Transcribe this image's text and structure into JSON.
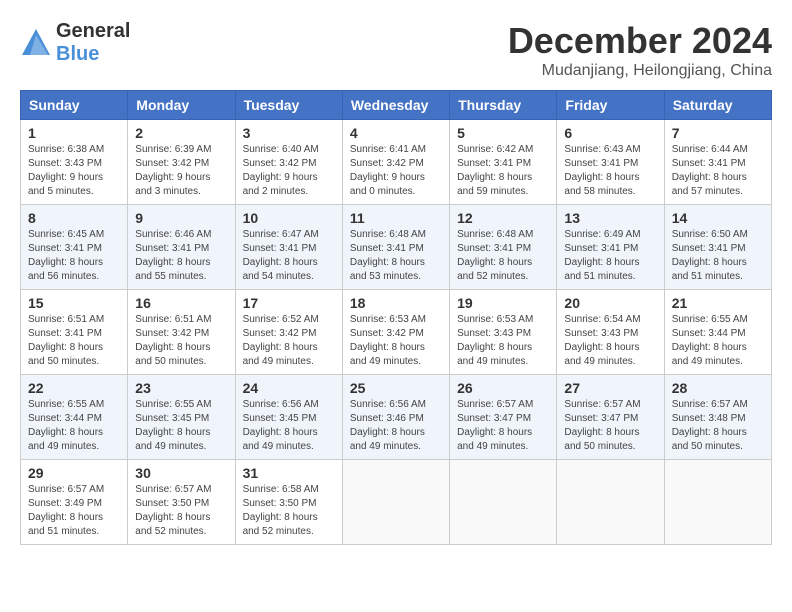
{
  "header": {
    "logo_general": "General",
    "logo_blue": "Blue",
    "month": "December 2024",
    "location": "Mudanjiang, Heilongjiang, China"
  },
  "weekdays": [
    "Sunday",
    "Monday",
    "Tuesday",
    "Wednesday",
    "Thursday",
    "Friday",
    "Saturday"
  ],
  "weeks": [
    [
      {
        "day": "1",
        "sunrise": "6:38 AM",
        "sunset": "3:43 PM",
        "daylight": "9 hours and 5 minutes."
      },
      {
        "day": "2",
        "sunrise": "6:39 AM",
        "sunset": "3:42 PM",
        "daylight": "9 hours and 3 minutes."
      },
      {
        "day": "3",
        "sunrise": "6:40 AM",
        "sunset": "3:42 PM",
        "daylight": "9 hours and 2 minutes."
      },
      {
        "day": "4",
        "sunrise": "6:41 AM",
        "sunset": "3:42 PM",
        "daylight": "9 hours and 0 minutes."
      },
      {
        "day": "5",
        "sunrise": "6:42 AM",
        "sunset": "3:41 PM",
        "daylight": "8 hours and 59 minutes."
      },
      {
        "day": "6",
        "sunrise": "6:43 AM",
        "sunset": "3:41 PM",
        "daylight": "8 hours and 58 minutes."
      },
      {
        "day": "7",
        "sunrise": "6:44 AM",
        "sunset": "3:41 PM",
        "daylight": "8 hours and 57 minutes."
      }
    ],
    [
      {
        "day": "8",
        "sunrise": "6:45 AM",
        "sunset": "3:41 PM",
        "daylight": "8 hours and 56 minutes."
      },
      {
        "day": "9",
        "sunrise": "6:46 AM",
        "sunset": "3:41 PM",
        "daylight": "8 hours and 55 minutes."
      },
      {
        "day": "10",
        "sunrise": "6:47 AM",
        "sunset": "3:41 PM",
        "daylight": "8 hours and 54 minutes."
      },
      {
        "day": "11",
        "sunrise": "6:48 AM",
        "sunset": "3:41 PM",
        "daylight": "8 hours and 53 minutes."
      },
      {
        "day": "12",
        "sunrise": "6:48 AM",
        "sunset": "3:41 PM",
        "daylight": "8 hours and 52 minutes."
      },
      {
        "day": "13",
        "sunrise": "6:49 AM",
        "sunset": "3:41 PM",
        "daylight": "8 hours and 51 minutes."
      },
      {
        "day": "14",
        "sunrise": "6:50 AM",
        "sunset": "3:41 PM",
        "daylight": "8 hours and 51 minutes."
      }
    ],
    [
      {
        "day": "15",
        "sunrise": "6:51 AM",
        "sunset": "3:41 PM",
        "daylight": "8 hours and 50 minutes."
      },
      {
        "day": "16",
        "sunrise": "6:51 AM",
        "sunset": "3:42 PM",
        "daylight": "8 hours and 50 minutes."
      },
      {
        "day": "17",
        "sunrise": "6:52 AM",
        "sunset": "3:42 PM",
        "daylight": "8 hours and 49 minutes."
      },
      {
        "day": "18",
        "sunrise": "6:53 AM",
        "sunset": "3:42 PM",
        "daylight": "8 hours and 49 minutes."
      },
      {
        "day": "19",
        "sunrise": "6:53 AM",
        "sunset": "3:43 PM",
        "daylight": "8 hours and 49 minutes."
      },
      {
        "day": "20",
        "sunrise": "6:54 AM",
        "sunset": "3:43 PM",
        "daylight": "8 hours and 49 minutes."
      },
      {
        "day": "21",
        "sunrise": "6:55 AM",
        "sunset": "3:44 PM",
        "daylight": "8 hours and 49 minutes."
      }
    ],
    [
      {
        "day": "22",
        "sunrise": "6:55 AM",
        "sunset": "3:44 PM",
        "daylight": "8 hours and 49 minutes."
      },
      {
        "day": "23",
        "sunrise": "6:55 AM",
        "sunset": "3:45 PM",
        "daylight": "8 hours and 49 minutes."
      },
      {
        "day": "24",
        "sunrise": "6:56 AM",
        "sunset": "3:45 PM",
        "daylight": "8 hours and 49 minutes."
      },
      {
        "day": "25",
        "sunrise": "6:56 AM",
        "sunset": "3:46 PM",
        "daylight": "8 hours and 49 minutes."
      },
      {
        "day": "26",
        "sunrise": "6:57 AM",
        "sunset": "3:47 PM",
        "daylight": "8 hours and 49 minutes."
      },
      {
        "day": "27",
        "sunrise": "6:57 AM",
        "sunset": "3:47 PM",
        "daylight": "8 hours and 50 minutes."
      },
      {
        "day": "28",
        "sunrise": "6:57 AM",
        "sunset": "3:48 PM",
        "daylight": "8 hours and 50 minutes."
      }
    ],
    [
      {
        "day": "29",
        "sunrise": "6:57 AM",
        "sunset": "3:49 PM",
        "daylight": "8 hours and 51 minutes."
      },
      {
        "day": "30",
        "sunrise": "6:57 AM",
        "sunset": "3:50 PM",
        "daylight": "8 hours and 52 minutes."
      },
      {
        "day": "31",
        "sunrise": "6:58 AM",
        "sunset": "3:50 PM",
        "daylight": "8 hours and 52 minutes."
      },
      null,
      null,
      null,
      null
    ]
  ]
}
